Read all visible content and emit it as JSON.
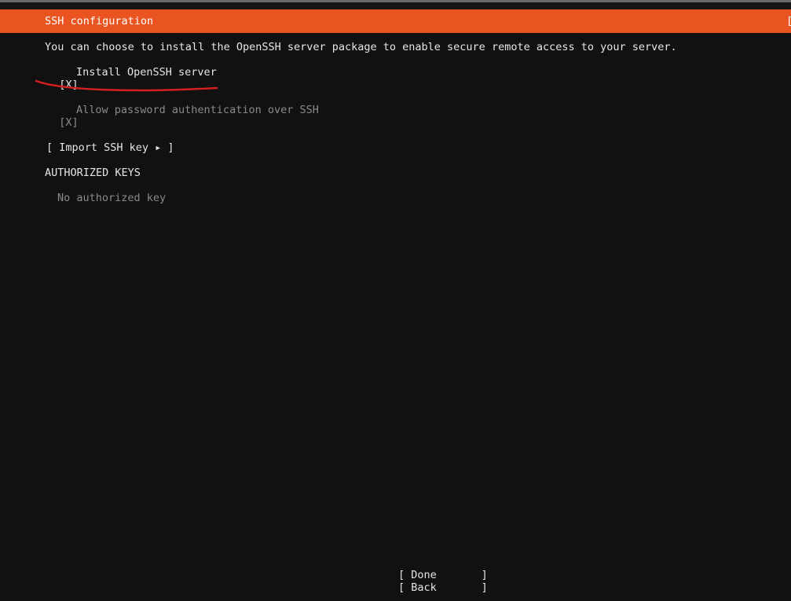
{
  "header": {
    "title": "SSH configuration",
    "right_bracket": "["
  },
  "description": "You can choose to install the OpenSSH server package to enable secure remote access to your server.",
  "install_openssh": {
    "checkbox": "[X]",
    "label": "Install OpenSSH server"
  },
  "allow_password": {
    "checkbox": "[X]",
    "label": "Allow password authentication over SSH"
  },
  "import_key_button": "[ Import SSH key ▸ ]",
  "authorized_keys": {
    "heading": "AUTHORIZED KEYS",
    "empty_text": "No authorized key"
  },
  "buttons": {
    "done": "[ Done       ]",
    "back": "[ Back       ]"
  },
  "colors": {
    "header_bg": "#e95420",
    "background": "#111111",
    "annotation": "#d42020"
  }
}
